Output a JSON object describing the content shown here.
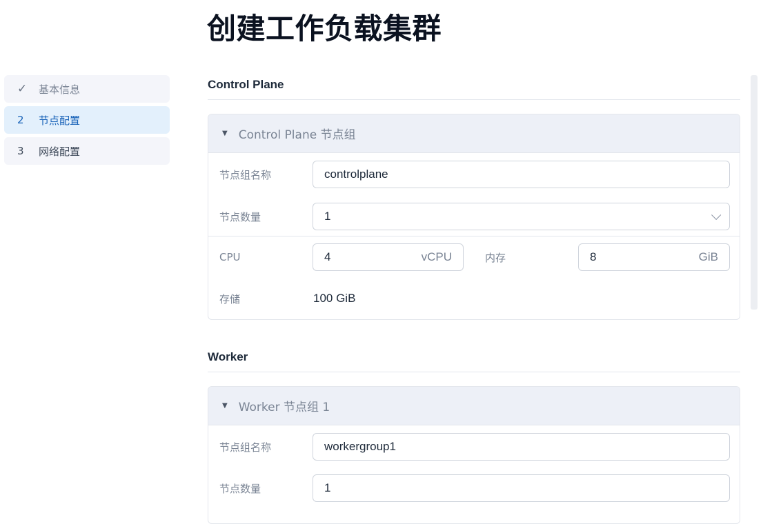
{
  "page": {
    "title": "创建工作负载集群"
  },
  "steps": [
    {
      "num": "✓",
      "label": "基本信息",
      "state": "done"
    },
    {
      "num": "2",
      "label": "节点配置",
      "state": "active"
    },
    {
      "num": "3",
      "label": "网络配置",
      "state": "pending"
    }
  ],
  "control_plane": {
    "section_title": "Control Plane",
    "group_title": "Control Plane 节点组",
    "name_label": "节点组名称",
    "name_value": "controlplane",
    "count_label": "节点数量",
    "count_value": "1",
    "cpu_label": "CPU",
    "cpu_value": "4",
    "cpu_unit": "vCPU",
    "mem_label": "内存",
    "mem_value": "8",
    "mem_unit": "GiB",
    "storage_label": "存储",
    "storage_value": "100 GiB"
  },
  "worker": {
    "section_title": "Worker",
    "group_title": "Worker 节点组 1",
    "name_label": "节点组名称",
    "name_value": "workergroup1",
    "count_label": "节点数量",
    "count_value": "1"
  },
  "colors": {
    "accent": "#1862b8",
    "active_bg": "#e3f0fc",
    "card_head_bg": "#edf0f7"
  }
}
